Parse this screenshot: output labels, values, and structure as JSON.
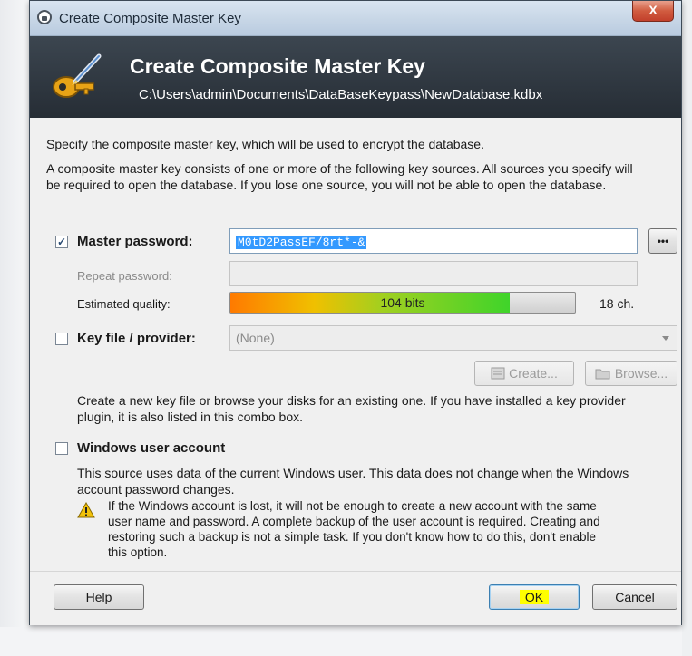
{
  "window": {
    "title": "Create Composite Master Key",
    "close_glyph": "X"
  },
  "banner": {
    "title": "Create Composite Master Key",
    "path": "C:\\Users\\admin\\Documents\\DataBaseKeypass\\NewDatabase.kdbx",
    "icon": "key-icon"
  },
  "intro": {
    "line1": "Specify the composite master key, which will be used to encrypt the database.",
    "line2a": "A composite master key consists of one or more of the following key sources. All sources you specify will",
    "line2b": "be required to open the database.  If you lose one source, you will not be able to open the database."
  },
  "master_password": {
    "checked": true,
    "label": "Master password:",
    "value": "M0tD2PassEF/8rt*-&",
    "reveal_label": "•••",
    "repeat_label": "Repeat password:",
    "repeat_value": "",
    "quality_label": "Estimated quality:",
    "quality_text": "104 bits",
    "quality_fraction": 0.81,
    "length_text": "18 ch."
  },
  "key_file": {
    "checked": false,
    "label": "Key file / provider:",
    "selected": "(None)",
    "create_label": "Create...",
    "browse_label": "Browse...",
    "help_line1": "Create a new key file or browse your disks for an existing one. If you have installed a key provider",
    "help_line2": "plugin, it is also listed in this combo box."
  },
  "windows_account": {
    "checked": false,
    "label": "Windows user account",
    "desc_line1": "This source uses data of the current Windows user. This data does not change when the Windows",
    "desc_line2": "account password changes.",
    "warning_lines": [
      "If the Windows account is lost, it will not be enough to create a new account with the same",
      "user name and password. A complete backup of the user account is required. Creating and",
      "restoring such a backup is not a simple task. If you don't know how to do this, don't enable",
      "this option."
    ]
  },
  "footer": {
    "help_label": "Help",
    "ok_label": "OK",
    "cancel_label": "Cancel"
  },
  "colors": {
    "banner_bg": "#2f3740",
    "quality_start": "#ff7a00",
    "quality_end": "#3fd42a",
    "ok_highlight": "#ffff00"
  }
}
